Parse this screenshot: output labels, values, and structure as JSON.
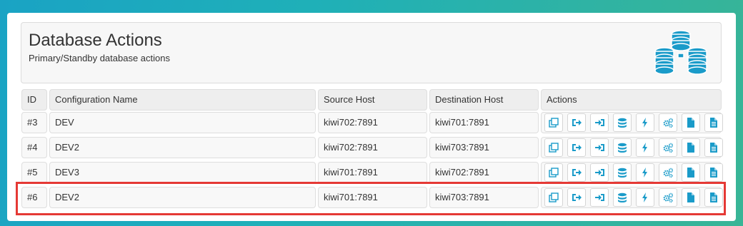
{
  "header": {
    "title": "Database Actions",
    "subtitle": "Primary/Standby database actions",
    "icon": "database-cluster-icon"
  },
  "table": {
    "columns": [
      "ID",
      "Configuration Name",
      "Source Host",
      "Destination Host",
      "Actions"
    ],
    "rows": [
      {
        "id": "#3",
        "name": "DEV",
        "source": "kiwi702:7891",
        "destination": "kiwi701:7891"
      },
      {
        "id": "#4",
        "name": "DEV2",
        "source": "kiwi702:7891",
        "destination": "kiwi703:7891"
      },
      {
        "id": "#5",
        "name": "DEV3",
        "source": "kiwi701:7891",
        "destination": "kiwi702:7891"
      },
      {
        "id": "#6",
        "name": "DEV2",
        "source": "kiwi701:7891",
        "destination": "kiwi703:7891"
      }
    ],
    "action_icons": [
      "copy-icon",
      "sign-out-icon",
      "sign-in-icon",
      "database-icon",
      "bolt-icon",
      "gears-icon",
      "file-icon",
      "file-text-icon"
    ],
    "highlighted_row": 3
  },
  "colors": {
    "accent": "#1a9bc9",
    "highlight": "#e53935"
  }
}
